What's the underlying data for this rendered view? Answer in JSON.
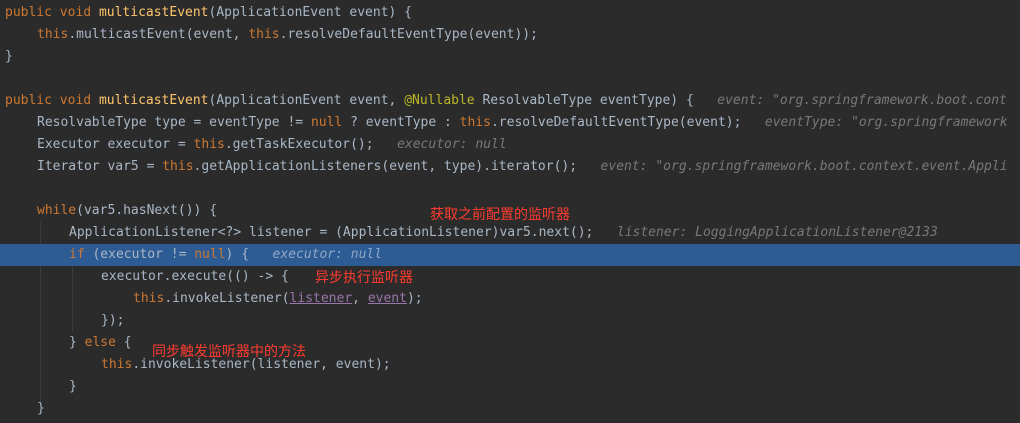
{
  "lines": {
    "l1": {
      "kw1": "public",
      "kw2": "void",
      "name": "multicastEvent",
      "rest": "(ApplicationEvent event) {"
    },
    "l2": {
      "kw1": "this",
      "t1": ".multicastEvent(event, ",
      "kw2": "this",
      "t2": ".resolveDefaultEventType(event));"
    },
    "l3": {
      "t1": "}"
    },
    "l5": {
      "kw1": "public",
      "kw2": "void",
      "name": "multicastEvent",
      "t1": "(ApplicationEvent event, ",
      "ann": "@Nullable",
      "t2": " ResolvableType eventType) {",
      "hint": "event: \"org.springframework.boot.cont"
    },
    "l6": {
      "t1": "ResolvableType type = eventType != ",
      "kw1": "null",
      "t2": " ? eventType : ",
      "kw2": "this",
      "t3": ".resolveDefaultEventType(event);",
      "hint": "eventType: \"org.springframework"
    },
    "l7": {
      "t1": "Executor executor = ",
      "kw1": "this",
      "t2": ".getTaskExecutor();",
      "hint": "executor: null"
    },
    "l8": {
      "t1": "Iterator var5 = ",
      "kw1": "this",
      "t2": ".getApplicationListeners(event, type).iterator();",
      "hint": "event: \"org.springframework.boot.context.event.Appli"
    },
    "l10": {
      "kw1": "while",
      "t1": "(var5.hasNext()) {"
    },
    "l11": {
      "t1": "ApplicationListener<?> listener = (ApplicationListener)var5.next();",
      "hint": "listener: LoggingApplicationListener@2133"
    },
    "l12": {
      "kw1": "if",
      "t1": " (executor != ",
      "kw2": "null",
      "t2": ") {",
      "hint": "executor: null"
    },
    "l13": {
      "t1": "executor.execute(() -> {"
    },
    "l14": {
      "kw1": "this",
      "t1": ".invokeListener(",
      "v1": "listener",
      "t2": ", ",
      "v2": "event",
      "t3": ");"
    },
    "l15": {
      "t1": "});"
    },
    "l16": {
      "t1": "} ",
      "kw1": "else",
      "t2": " {"
    },
    "l17": {
      "kw1": "this",
      "t1": ".invokeListener(listener, event);"
    },
    "l18": {
      "t1": "}"
    },
    "l19": {
      "t1": "}"
    }
  },
  "annotations": {
    "get_listeners": "获取之前配置的监听器",
    "async_exec": "异步执行监听器",
    "sync_trigger": "同步触发监听器中的方法"
  },
  "colors": {
    "background": "#2b2b2b",
    "current_line": "#2d5b93",
    "keyword": "#cc7832",
    "method_decl": "#ffc66d",
    "annotation": "#bbb529",
    "inlay_hint": "#787878",
    "note_red": "#ff3b2f"
  }
}
